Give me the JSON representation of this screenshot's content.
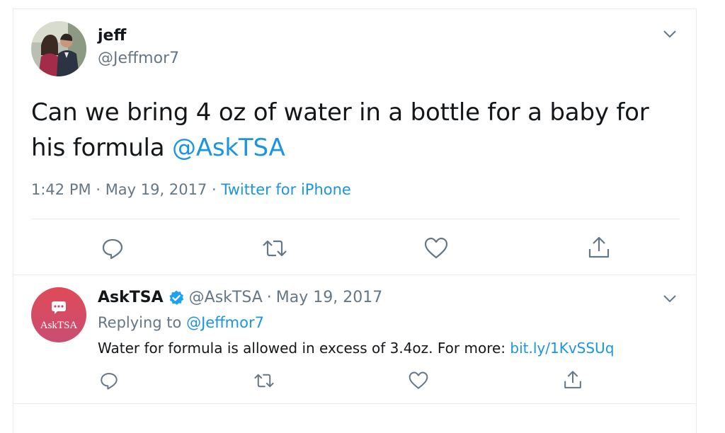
{
  "main_tweet": {
    "display_name": "jeff",
    "handle": "@Jeffmor7",
    "text": "Can we bring 4 oz of water in a bottle for a baby for his formula",
    "mention": "@AskTSA",
    "time": "1:42 PM",
    "date": "May 19, 2017",
    "source": "Twitter for iPhone",
    "separator": "·"
  },
  "reply_tweet": {
    "display_name": "AskTSA",
    "handle": "@AskTSA",
    "date": "May 19, 2017",
    "separator": "·",
    "replying_prefix": "Replying to",
    "replying_handle": "@Jeffmor7",
    "text": "Water for formula is allowed in excess of 3.4oz. For more:",
    "link": "bit.ly/1KvSSUq",
    "avatar_text": "AskTSA"
  },
  "icons": [
    "chevron-down-icon",
    "reply-icon",
    "retweet-icon",
    "like-icon",
    "share-icon",
    "verified-badge-icon",
    "chat-bubble-icon"
  ],
  "colors": {
    "accent": "#1b95e0",
    "secondary_text": "#657786",
    "tsa_gradient": [
      "#e04a57",
      "#c94e73"
    ]
  }
}
